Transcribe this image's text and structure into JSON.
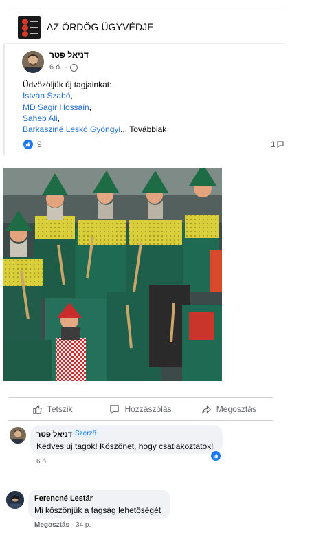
{
  "group": {
    "name": "AZ ÖRDÖG ÜGYVÉDJE"
  },
  "post": {
    "author": "דניאל פטר",
    "time": "6 ó.",
    "intro": "Üdvözöljük új tagjainkat:",
    "members": [
      "István Szabó",
      "MD Sagir Hossain",
      "Saheb Ali",
      "Barkasziné Leskó Gyöngyi"
    ],
    "member_separators": [
      ",",
      ",",
      ",",
      ""
    ],
    "ellipsis": "...",
    "more_label": "Továbbiak",
    "reaction_count": "9",
    "comment_count": "1"
  },
  "actions": {
    "like": "Tetszik",
    "comment": "Hozzászólás",
    "share": "Megosztás"
  },
  "comments": [
    {
      "author": "דניאל פטר",
      "badge": "Szerző",
      "text": "Kedves új tagok! Köszönet, hogy csatlakoztatok!",
      "time": "6 ó."
    },
    {
      "author": "Ferencné Lestár",
      "text": "Mi köszönjük a tagság lehetőségét",
      "share_label": "Megosztás",
      "time": "34 p."
    }
  ],
  "colors": {
    "link": "#216fdb",
    "like_blue": "#1877f2",
    "muted": "#65676b"
  },
  "icons": [
    "globe-icon",
    "like-reaction-icon",
    "comment-icon",
    "thumb-up-icon",
    "speech-bubble-icon",
    "share-arrow-icon"
  ]
}
